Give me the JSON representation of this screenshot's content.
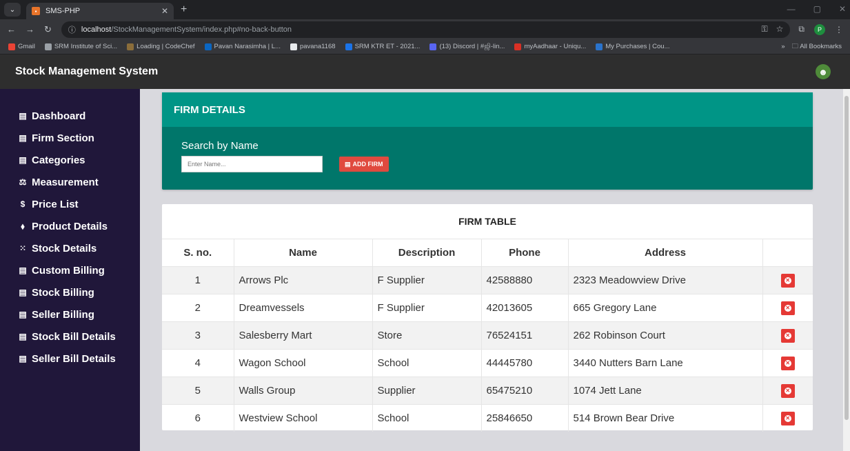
{
  "browser": {
    "tab_title": "SMS-PHP",
    "url_host": "localhost",
    "url_path": "/StockManagementSystem/index.php#no-back-button",
    "profile_initial": "P",
    "bookmarks": [
      {
        "label": "Gmail",
        "color": "#ea4335"
      },
      {
        "label": "SRM Institute of Sci...",
        "color": "#9aa0a6"
      },
      {
        "label": "Loading | CodeChef",
        "color": "#8b6d3a"
      },
      {
        "label": "Pavan Narasimha | L...",
        "color": "#0a66c2"
      },
      {
        "label": "pavana1168",
        "color": "#e8eaed"
      },
      {
        "label": "SRM KTR ET - 2021...",
        "color": "#1a73e8"
      },
      {
        "label": "(13) Discord | #ஜி-lin...",
        "color": "#5865f2"
      },
      {
        "label": "myAadhaar - Uniqu...",
        "color": "#d93025"
      },
      {
        "label": "My Purchases | Cou...",
        "color": "#2a73cc"
      }
    ],
    "all_bookmarks": "All Bookmarks"
  },
  "app": {
    "title": "Stock Management System"
  },
  "sidebar": {
    "items": [
      {
        "label": "Dashboard",
        "icon": "▤"
      },
      {
        "label": "Firm Section",
        "icon": "▤"
      },
      {
        "label": "Categories",
        "icon": "▤"
      },
      {
        "label": "Measurement",
        "icon": "⚖"
      },
      {
        "label": "Price List",
        "icon": "$"
      },
      {
        "label": "Product Details",
        "icon": "⬧"
      },
      {
        "label": "Stock Details",
        "icon": "⁙"
      },
      {
        "label": "Custom Billing",
        "icon": "▤"
      },
      {
        "label": "Stock Billing",
        "icon": "▤"
      },
      {
        "label": "Seller Billing",
        "icon": "▤"
      },
      {
        "label": "Stock Bill Details",
        "icon": "▤"
      },
      {
        "label": "Seller Bill Details",
        "icon": "▤"
      }
    ]
  },
  "firm": {
    "header": "FIRM DETAILS",
    "search_label": "Search by Name",
    "search_placeholder": "Enter Name...",
    "add_button": "ADD FIRM"
  },
  "table": {
    "title": "FIRM TABLE",
    "columns": [
      "S. no.",
      "Name",
      "Description",
      "Phone",
      "Address",
      ""
    ],
    "rows": [
      [
        "1",
        "Arrows Plc",
        "F Supplier",
        "42588880",
        "2323 Meadowview Drive"
      ],
      [
        "2",
        "Dreamvessels",
        "F Supplier",
        "42013605",
        "665 Gregory Lane"
      ],
      [
        "3",
        "Salesberry Mart",
        "Store",
        "76524151",
        "262 Robinson Court"
      ],
      [
        "4",
        "Wagon School",
        "School",
        "44445780",
        "3440 Nutters Barn Lane"
      ],
      [
        "5",
        "Walls Group",
        "Supplier",
        "65475210",
        "1074 Jett Lane"
      ],
      [
        "6",
        "Westview School",
        "School",
        "25846650",
        "514 Brown Bear Drive"
      ]
    ]
  }
}
